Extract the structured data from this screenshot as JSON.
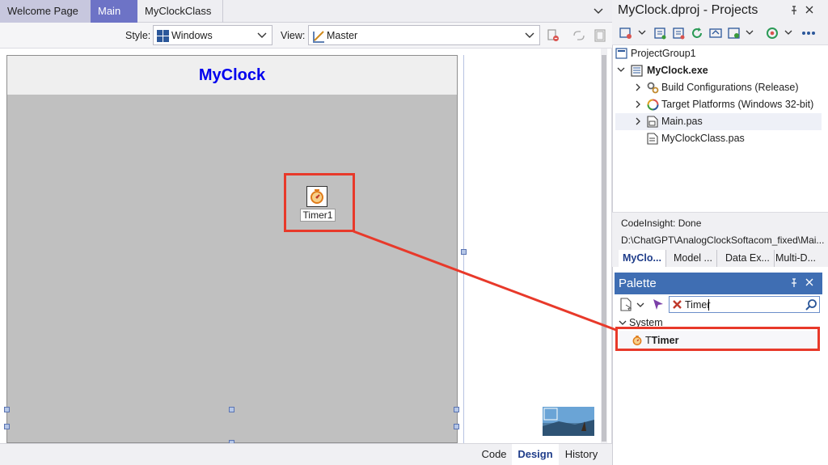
{
  "editor_tabs": [
    {
      "label": "Welcome Page"
    },
    {
      "label": "Main"
    },
    {
      "label": "MyClockClass"
    }
  ],
  "design_toolbar": {
    "style_label": "Style:",
    "style_value": "Windows",
    "view_label": "View:",
    "view_value": "Master"
  },
  "form": {
    "caption": "MyClock",
    "timer_component_label": "Timer1"
  },
  "bottom_tabs": [
    "Code",
    "Design",
    "History"
  ],
  "projects_panel": {
    "title": "MyClock.dproj - Projects",
    "tree": {
      "group": "ProjectGroup1",
      "project": "MyClock.exe",
      "build_configs": "Build Configurations (Release)",
      "target_platforms": "Target Platforms (Windows 32-bit)",
      "main_unit": "Main.pas",
      "class_unit": "MyClockClass.pas"
    },
    "status_line1": "CodeInsight: Done",
    "status_line2": "D:\\ChatGPT\\AnalogClockSoftacom_fixed\\Mai...",
    "sub_tabs": [
      "MyClo...",
      "Model ...",
      "Data Ex...",
      "Multi-D..."
    ]
  },
  "palette": {
    "title": "Palette",
    "search_value": "Timer",
    "category": "System",
    "item_prefix": "T",
    "item_match": "Timer"
  },
  "colors": {
    "accent_tab": "#6d73c6",
    "palette_header": "#3f6eb3",
    "form_caption": "#0000ee",
    "annotation_red": "#e8392a"
  }
}
